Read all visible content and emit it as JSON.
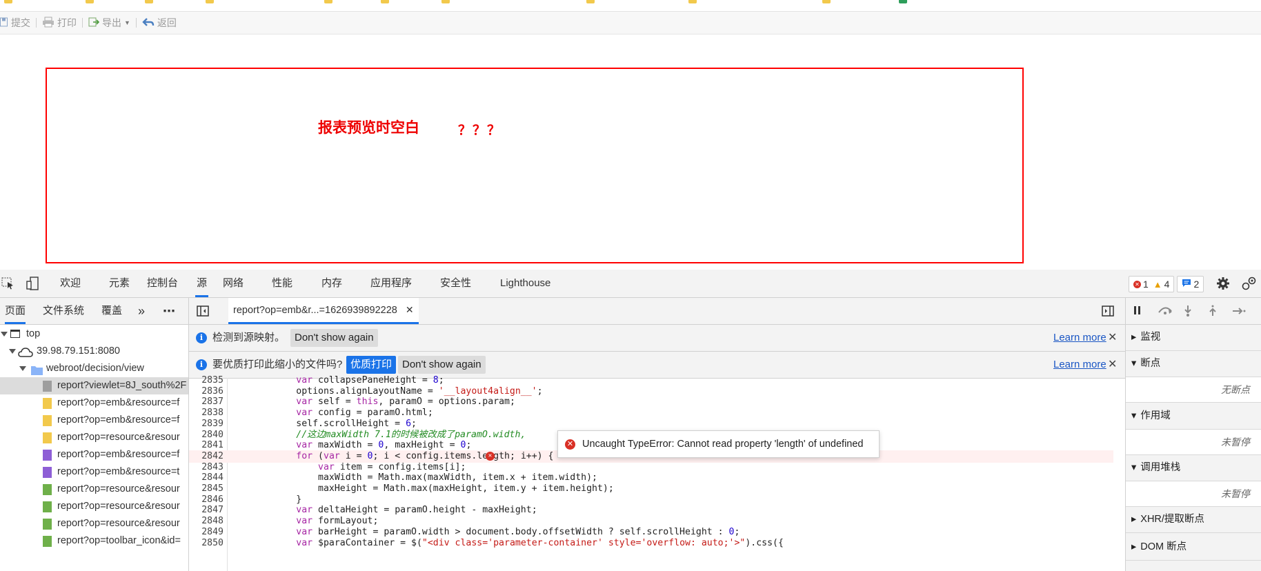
{
  "report_toolbar": {
    "submit": "提交",
    "print": "打印",
    "export": "导出",
    "back": "返回"
  },
  "report": {
    "text_main": "报表预览时空白",
    "text_question": "？？？"
  },
  "devtools": {
    "tabs": [
      "欢迎",
      "元素",
      "控制台",
      "源",
      "网络",
      "性能",
      "内存",
      "应用程序",
      "安全性",
      "Lighthouse"
    ],
    "active_tab": "源",
    "errors": "1",
    "warnings": "4",
    "messages": "2",
    "nav_tabs": [
      "页面",
      "文件系统",
      "覆盖"
    ],
    "tree": {
      "top": "top",
      "host": "39.98.79.151:8080",
      "folder": "webroot/decision/view",
      "files": [
        {
          "name": "report?viewlet=8J_south%2F",
          "color": "#9e9e9e"
        },
        {
          "name": "report?op=emb&resource=f",
          "color": "#f2c94c"
        },
        {
          "name": "report?op=emb&resource=f",
          "color": "#f2c94c"
        },
        {
          "name": "report?op=resource&resour",
          "color": "#f2c94c"
        },
        {
          "name": "report?op=emb&resource=f",
          "color": "#8e5fd6"
        },
        {
          "name": "report?op=emb&resource=t",
          "color": "#8e5fd6"
        },
        {
          "name": "report?op=resource&resour",
          "color": "#6fb04a"
        },
        {
          "name": "report?op=resource&resour",
          "color": "#6fb04a"
        },
        {
          "name": "report?op=resource&resour",
          "color": "#6fb04a"
        },
        {
          "name": "report?op=toolbar_icon&id=",
          "color": "#6fb04a"
        }
      ]
    },
    "editor_tab": "report?op=emb&r...=1626939892228",
    "infobar1": {
      "text": "检测到源映射。",
      "dismiss": "Don't show again",
      "learn": "Learn more"
    },
    "infobar2": {
      "text": "要优质打印此缩小的文件吗?",
      "action": "优质打印",
      "dismiss": "Don't show again",
      "learn": "Learn more"
    },
    "code_lines": [
      {
        "n": "2835",
        "c": "            var collapsePaneHeight = 8;"
      },
      {
        "n": "2836",
        "c": "            options.alignLayoutName = '__layout4align__';"
      },
      {
        "n": "2837",
        "c": "            var self = this, paramO = options.param;"
      },
      {
        "n": "2838",
        "c": "            var config = paramO.html;"
      },
      {
        "n": "2839",
        "c": "            self.scrollHeight = 6;"
      },
      {
        "n": "2840",
        "c": "            //这边maxWidth 7.1的时候被改成了paramO.width,"
      },
      {
        "n": "2841",
        "c": "            var maxWidth = 0, maxHeight = 0;"
      },
      {
        "n": "2842",
        "c": "            for (var i = 0; i < config.items.length; i++) {"
      },
      {
        "n": "2843",
        "c": "                var item = config.items[i];"
      },
      {
        "n": "2844",
        "c": "                maxWidth = Math.max(maxWidth, item.x + item.width);"
      },
      {
        "n": "2845",
        "c": "                maxHeight = Math.max(maxHeight, item.y + item.height);"
      },
      {
        "n": "2846",
        "c": "            }"
      },
      {
        "n": "2847",
        "c": "            var deltaHeight = paramO.height - maxHeight;"
      },
      {
        "n": "2848",
        "c": "            var formLayout;"
      },
      {
        "n": "2849",
        "c": "            var barHeight = paramO.width > document.body.offsetWidth ? self.scrollHeight : 0;"
      },
      {
        "n": "2850",
        "c": "            var $paraContainer = $(\"<div class='parameter-container' style='overflow: auto;'>\").css({"
      }
    ],
    "error_line": "2842",
    "error_message": "Uncaught TypeError: Cannot read property 'length' of undefined",
    "debugger": {
      "watch": "监视",
      "breakpoints": "断点",
      "no_breakpoints": "无断点",
      "scope": "作用域",
      "not_paused": "未暂停",
      "call_stack": "调用堆栈",
      "not_paused2": "未暂停",
      "xhr": "XHR/提取断点",
      "dom": "DOM 断点"
    }
  }
}
